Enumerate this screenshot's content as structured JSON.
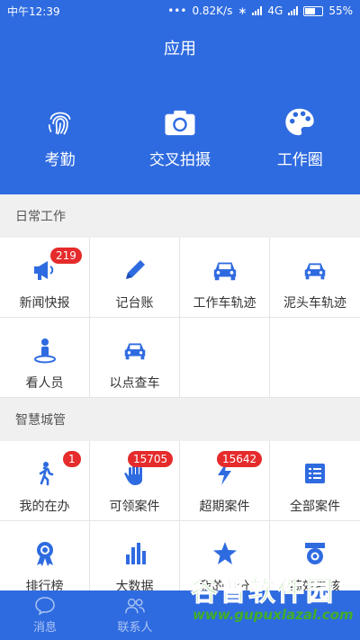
{
  "status_bar": {
    "time": "中午12:39",
    "net_speed": "0.82K/s",
    "network": "4G",
    "battery": "55%",
    "battery_level": 0.55
  },
  "header": {
    "title": "应用",
    "actions": [
      {
        "label": "考勤",
        "icon": "fingerprint-icon"
      },
      {
        "label": "交叉拍摄",
        "icon": "camera-icon"
      },
      {
        "label": "工作圈",
        "icon": "palette-icon"
      }
    ]
  },
  "sections": [
    {
      "title": "日常工作",
      "items": [
        {
          "label": "新闻快报",
          "icon": "megaphone-icon",
          "badge": "219"
        },
        {
          "label": "记台账",
          "icon": "pencil-icon",
          "badge": ""
        },
        {
          "label": "工作车轨迹",
          "icon": "car-icon",
          "badge": ""
        },
        {
          "label": "泥头车轨迹",
          "icon": "truck-icon",
          "badge": ""
        },
        {
          "label": "看人员",
          "icon": "person-pin-icon",
          "badge": ""
        },
        {
          "label": "以点查车",
          "icon": "car-search-icon",
          "badge": ""
        }
      ]
    },
    {
      "title": "智慧城管",
      "items": [
        {
          "label": "我的在办",
          "icon": "walking-icon",
          "badge": "1"
        },
        {
          "label": "可领案件",
          "icon": "hand-icon",
          "badge": "15705"
        },
        {
          "label": "超期案件",
          "icon": "flash-icon",
          "badge": "15642"
        },
        {
          "label": "全部案件",
          "icon": "list-icon",
          "badge": ""
        },
        {
          "label": "排行榜",
          "icon": "medal-icon",
          "badge": ""
        },
        {
          "label": "大数据",
          "icon": "bar-chart-icon",
          "badge": ""
        },
        {
          "label": "我的工分",
          "icon": "star-icon",
          "badge": ""
        },
        {
          "label": "绩效考核",
          "icon": "badge-icon",
          "badge": ""
        }
      ]
    }
  ],
  "bottom_nav": [
    {
      "label": "消息",
      "icon": "chat-icon"
    },
    {
      "label": "联系人",
      "icon": "contacts-icon"
    }
  ],
  "watermark": {
    "title": "谷普软件园",
    "url": "www.gupuxlazal.com"
  },
  "colors": {
    "primary": "#2f6be0",
    "icon": "#2f6be0",
    "badge": "#e52b2b",
    "watermark": "#3fae2a"
  }
}
